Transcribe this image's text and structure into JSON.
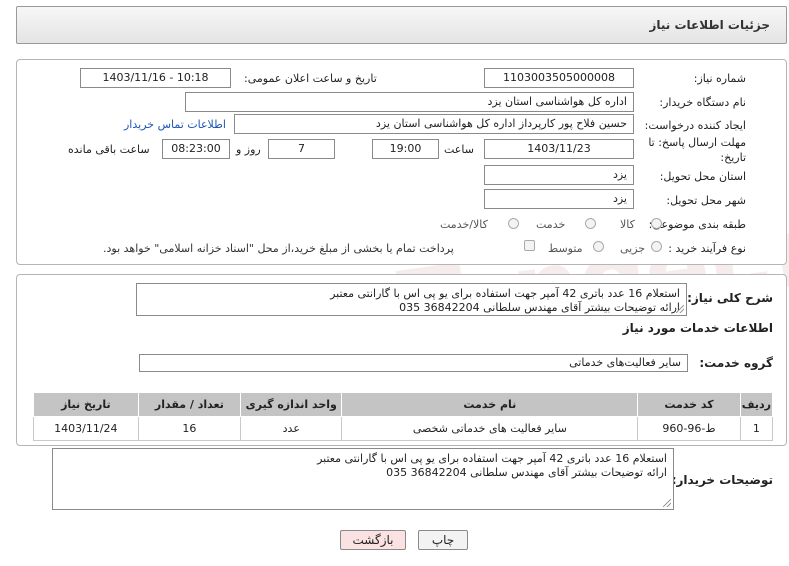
{
  "header": {
    "title": "جزئیات اطلاعات نیاز"
  },
  "watermark": "AriaTender.neT",
  "form": {
    "need_number_label": "شماره نیاز:",
    "need_number": "1103003505000008",
    "announce_label": "تاریخ و ساعت اعلان عمومی:",
    "announce_value": "1403/11/16 - 10:18",
    "buyer_org_label": "نام دستگاه خریدار:",
    "buyer_org": "اداره کل هواشناسی استان یزد",
    "creator_label": "ایجاد کننده درخواست:",
    "creator": "حسین  فلاح پور کارپرداز اداره کل هواشناسی استان یزد",
    "contact_link": "اطلاعات تماس خریدار",
    "deadline_label_1": "مهلت ارسال پاسخ: تا",
    "deadline_label_2": "تاریخ:",
    "deadline_date": "1403/11/23",
    "time_label": "ساعت",
    "deadline_time": "19:00",
    "days_value": "7",
    "days_label": "روز و",
    "remaining_time": "08:23:00",
    "remaining_label": "ساعت باقی مانده",
    "province_label": "استان محل تحویل:",
    "province": "یزد",
    "city_label": "شهر محل تحویل:",
    "city": "یزد",
    "category_label": "طبقه بندی موضوعی:",
    "category_options": [
      "کالا",
      "خدمت",
      "کالا/خدمت"
    ],
    "process_label": "نوع فرآیند خرید :",
    "process_options": [
      "جزیی",
      "متوسط"
    ],
    "payment_note": "پرداخت تمام یا بخشی از مبلغ خرید،از محل \"اسناد خزانه اسلامی\" خواهد بود."
  },
  "summary": {
    "label": "شرح کلی نیاز:",
    "line1": "استعلام 16 عدد باتری 42 آمپر  جهت استفاده برای یو پی اس با گارانتی معتبر",
    "line2": "ارائه توضیحات بیشتر آقای مهندس سلطانی 36842204 035"
  },
  "services": {
    "section_title": "اطلاعات خدمات مورد نیاز",
    "group_label": "گروه خدمت:",
    "group_value": "سایر فعالیت‌های خدماتی",
    "columns": [
      "ردیف",
      "کد خدمت",
      "نام خدمت",
      "واحد اندازه گیری",
      "تعداد / مقدار",
      "تاریخ نیاز"
    ],
    "rows": [
      {
        "idx": "1",
        "code": "ط-96-960",
        "name": "سایر فعالیت های خدماتی شخصی",
        "unit": "عدد",
        "qty": "16",
        "date": "1403/11/24"
      }
    ]
  },
  "buyer_notes": {
    "label": "توضیحات خریدار:",
    "line1": "استعلام 16 عدد باتری 42 آمپر  جهت استفاده برای یو پی اس با گارانتی معتبر",
    "line2": "ارائه توضیحات بیشتر آقای مهندس سلطانی 36842204 035"
  },
  "buttons": {
    "print": "چاپ",
    "back": "بازگشت"
  },
  "colors": {
    "link": "#1f55b5",
    "table_header": "#c4c4c4",
    "back_button_bg": "#fbe2e2"
  }
}
